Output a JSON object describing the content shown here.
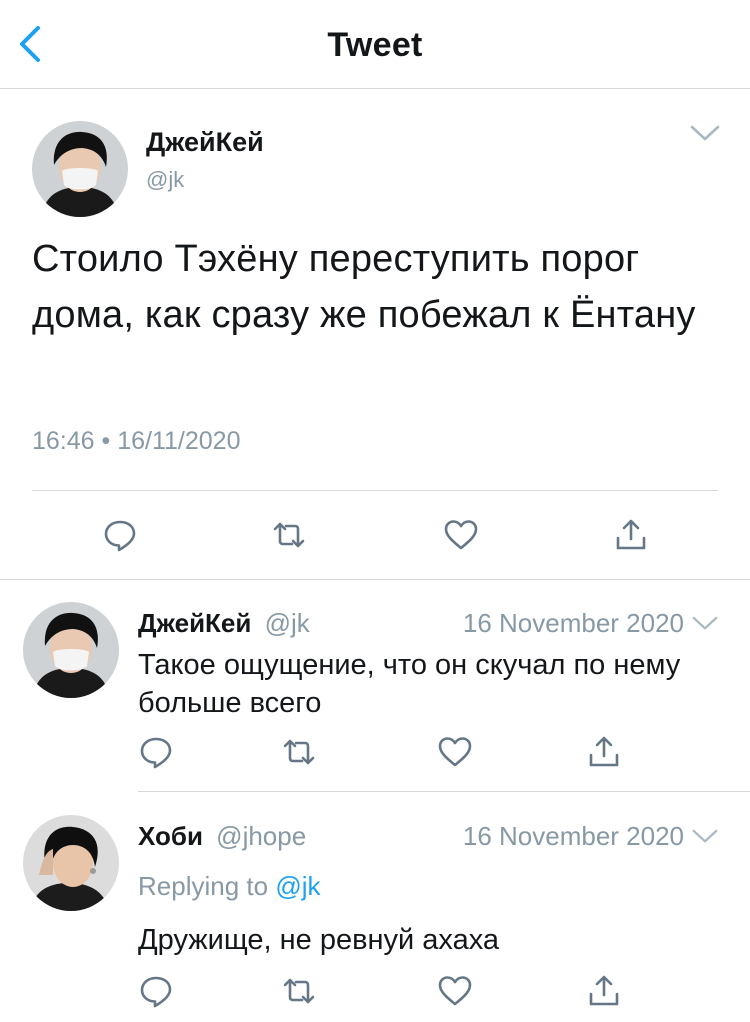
{
  "nav": {
    "title": "Tweet"
  },
  "colors": {
    "accent": "#1da1f2",
    "secondary_text": "#8899a6",
    "divider": "#d6d9dc"
  },
  "main_tweet": {
    "author_name": "ДжейКей",
    "author_handle": "@jk",
    "text": "Стоило Тэхёну переступить порог дома, как сразу же побежал к Ёнтану",
    "timestamp": "16:46 • 16/11/2020"
  },
  "replies": [
    {
      "author_name": "ДжейКей",
      "author_handle": "@jk",
      "date": "16 November 2020",
      "text": "Такое ощущение, что он скучал по нему больше всего"
    },
    {
      "author_name": "Хоби",
      "author_handle": "@jhope",
      "date": "16 November 2020",
      "replying_prefix": "Replying to",
      "replying_to": "@jk",
      "text": "Дружище, не ревнуй ахаха"
    }
  ],
  "icons": [
    "back-chevron-icon",
    "chevron-down-icon",
    "reply-icon",
    "retweet-icon",
    "like-icon",
    "share-icon",
    "avatar-image"
  ]
}
